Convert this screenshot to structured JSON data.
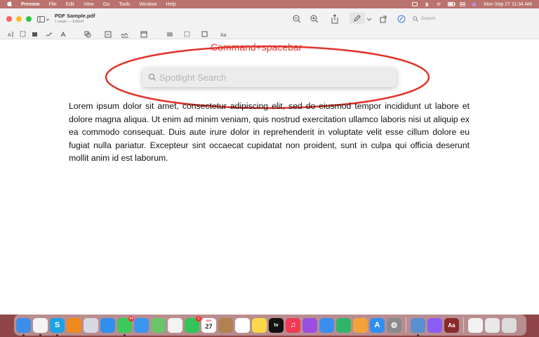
{
  "menubar": {
    "apple": "",
    "items": [
      "Preview",
      "File",
      "Edit",
      "View",
      "Go",
      "Tools",
      "Window",
      "Help"
    ],
    "clock": "Mon Sep 27  11:34 AM",
    "status_icons": [
      "screen-mirror-icon",
      "bluetooth-icon",
      "wifi-icon",
      "battery-icon",
      "control-center-icon",
      "siri-icon"
    ]
  },
  "window": {
    "title": "PDF Sample.pdf",
    "subtitle": "1 page — Edited",
    "search_placeholder": "Search",
    "markup_tools": [
      "text-selection-icon",
      "rect-selection-icon",
      "redact-icon",
      "sketch-icon",
      "draw-icon",
      "shapes-icon",
      "text-box-icon",
      "sign-icon",
      "note-icon",
      "shape-style-icon",
      "border-color-icon",
      "fill-color-icon",
      "text-style-icon"
    ]
  },
  "annotation": {
    "label": "Command+spacebar",
    "color": "#e0342a"
  },
  "spotlight": {
    "placeholder": "Spotlight Search"
  },
  "document": {
    "body": "Lorem ipsum dolor sit amet, consectetur adipiscing elit, sed do eiusmod tempor incididunt ut labore et dolore magna aliqua. Ut enim ad minim veniam, quis nostrud exercitation ullamco laboris nisi ut aliquip ex ea commodo consequat. Duis aute irure dolor in reprehenderit in voluptate velit esse cillum dolore eu fugiat nulla pariatur. Excepteur sint occaecat cupidatat non proident, sunt in culpa qui officia deserunt mollit anim id est laborum."
  },
  "dock": {
    "apps": [
      {
        "name": "finder-icon",
        "color": "#3d8ee8",
        "glyph": "",
        "running": true
      },
      {
        "name": "chrome-icon",
        "color": "#f4f4f4",
        "glyph": "",
        "running": true
      },
      {
        "name": "skype-icon",
        "color": "#1da1e6",
        "glyph": "S",
        "running": true
      },
      {
        "name": "vlc-icon",
        "color": "#f08a1c",
        "glyph": "",
        "running": false
      },
      {
        "name": "launchpad-icon",
        "color": "#d8d8e0",
        "glyph": "",
        "running": false
      },
      {
        "name": "safari-icon",
        "color": "#2f8ff0",
        "glyph": "",
        "running": false
      },
      {
        "name": "messages-icon",
        "color": "#3bc95a",
        "glyph": "",
        "running": true,
        "badge": "44"
      },
      {
        "name": "mail-icon",
        "color": "#3d95f2",
        "glyph": "",
        "running": false
      },
      {
        "name": "maps-icon",
        "color": "#6cc46a",
        "glyph": "",
        "running": false
      },
      {
        "name": "photos-icon",
        "color": "#f3f3f3",
        "glyph": "",
        "running": false
      },
      {
        "name": "facetime-icon",
        "color": "#33c459",
        "glyph": "",
        "running": false,
        "badge": "1"
      },
      {
        "name": "calendar-icon",
        "color": "#ffffff",
        "glyph": "27",
        "running": false,
        "month": "SEP"
      },
      {
        "name": "notes-brown-icon",
        "color": "#b08250",
        "glyph": "",
        "running": false
      },
      {
        "name": "reminders-icon",
        "color": "#ffffff",
        "glyph": "",
        "running": false
      },
      {
        "name": "notes-icon",
        "color": "#fbd84a",
        "glyph": "",
        "running": false
      },
      {
        "name": "apple-tv-icon",
        "color": "#111111",
        "glyph": "tv",
        "running": false
      },
      {
        "name": "music-icon",
        "color": "#f23a55",
        "glyph": "♫",
        "running": false
      },
      {
        "name": "podcasts-icon",
        "color": "#9a4fe0",
        "glyph": "",
        "running": false
      },
      {
        "name": "keynote-icon",
        "color": "#3a8ef0",
        "glyph": "",
        "running": false
      },
      {
        "name": "numbers-icon",
        "color": "#2fb56a",
        "glyph": "",
        "running": false
      },
      {
        "name": "pages-icon",
        "color": "#f2a33a",
        "glyph": "",
        "running": false
      },
      {
        "name": "app-store-icon",
        "color": "#2f8ff0",
        "glyph": "A",
        "running": false
      },
      {
        "name": "system-preferences-icon",
        "color": "#8a8a8a",
        "glyph": "⚙",
        "running": false
      },
      {
        "sep": true
      },
      {
        "name": "preview-icon",
        "color": "#5a8fd0",
        "glyph": "",
        "running": true
      },
      {
        "name": "messenger-icon",
        "color": "#8b5cf6",
        "glyph": "",
        "running": false
      },
      {
        "name": "dictionary-icon",
        "color": "#8b2a2a",
        "glyph": "Aa",
        "running": false
      },
      {
        "sep": true
      },
      {
        "name": "downloads-stack-icon",
        "color": "#f2f2f2",
        "glyph": "",
        "running": false
      },
      {
        "name": "documents-stack-icon",
        "color": "#e8e8e8",
        "glyph": "",
        "running": false
      },
      {
        "name": "trash-icon",
        "color": "#dcdcdc",
        "glyph": "",
        "running": false
      }
    ]
  }
}
